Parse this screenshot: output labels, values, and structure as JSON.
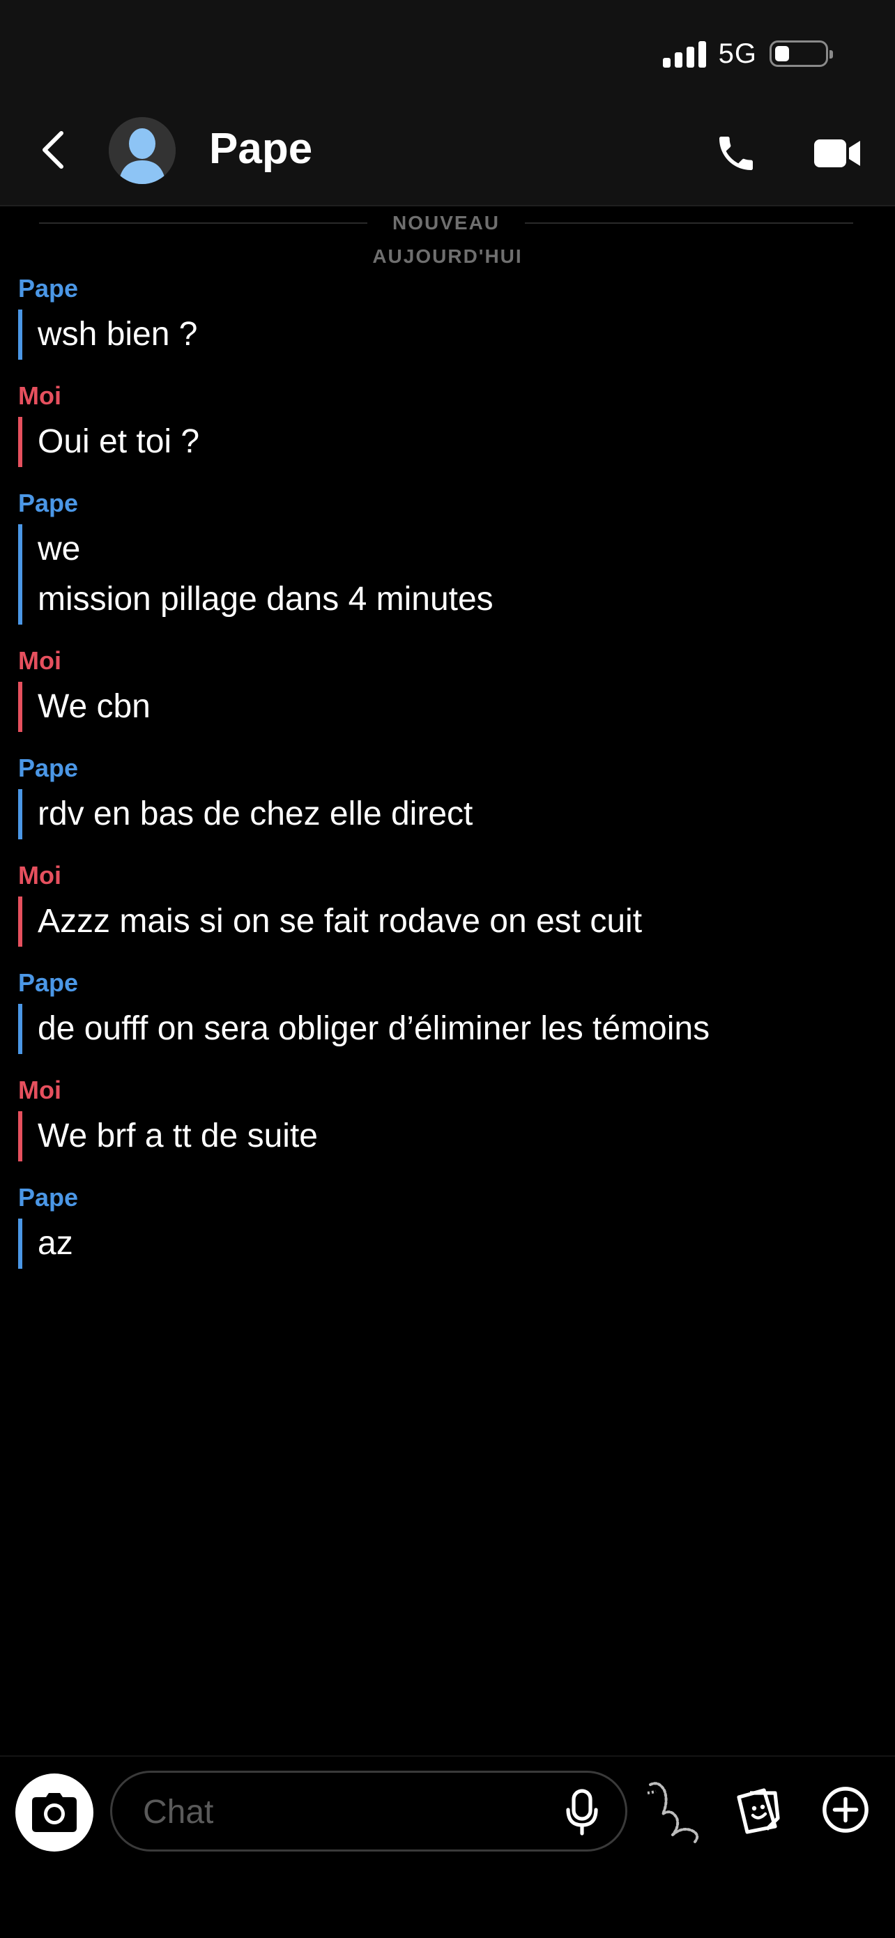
{
  "status_bar": {
    "network": "5G",
    "battery_level": 0.15
  },
  "header": {
    "contact_name": "Pape",
    "icons": {
      "back": "chevron-left-icon",
      "avatar": "user-silhouette-icon",
      "call": "phone-icon",
      "video": "video-camera-icon"
    }
  },
  "dividers": {
    "new_label": "NOUVEAU",
    "day_label": "AUJOURD'HUI"
  },
  "messages": [
    {
      "sender": "Pape",
      "lines": [
        "wsh bien ?"
      ]
    },
    {
      "sender": "Moi",
      "lines": [
        "Oui et toi ?"
      ]
    },
    {
      "sender": "Pape",
      "lines": [
        "we",
        "mission pillage dans 4 minutes"
      ]
    },
    {
      "sender": "Moi",
      "lines": [
        "We cbn"
      ]
    },
    {
      "sender": "Pape",
      "lines": [
        "rdv en bas de chez elle direct"
      ]
    },
    {
      "sender": "Moi",
      "lines": [
        "Azzz mais si on se fait rodave on est cuit"
      ]
    },
    {
      "sender": "Pape",
      "lines": [
        "de oufff on sera obliger d’éliminer les témoins"
      ]
    },
    {
      "sender": "Moi",
      "lines": [
        "We brf a tt de suite"
      ]
    },
    {
      "sender": "Pape",
      "lines": [
        "az"
      ]
    }
  ],
  "composer": {
    "placeholder": "Chat",
    "value": "",
    "icons": {
      "camera": "camera-icon",
      "mic": "microphone-icon",
      "bitmoji": "bitmoji-icon",
      "sticker": "sticker-icon",
      "plus": "plus-circle-icon"
    }
  },
  "colors": {
    "friend_accent": "#4b97e6",
    "self_accent": "#e6505e",
    "header_bg": "#121212",
    "background": "#000000"
  }
}
